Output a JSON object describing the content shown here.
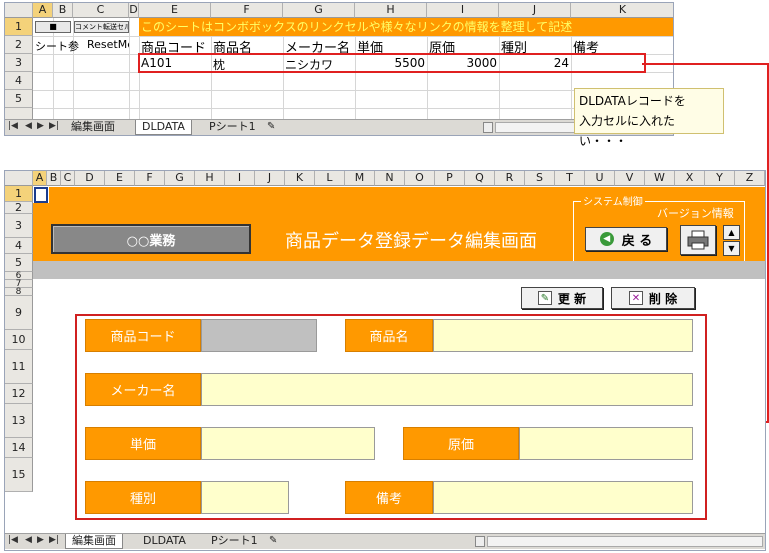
{
  "top_sheet": {
    "columns": [
      "A",
      "B",
      "C",
      "D",
      "E",
      "F",
      "G",
      "H",
      "I",
      "J",
      "K"
    ],
    "rows": [
      "1",
      "2",
      "3",
      "4",
      "5"
    ],
    "row1_banner": "このシートはコンボボックスのリンクセルや様々なリンクの情報を整理して記述",
    "row1_btn_black": "■",
    "row1_btn_comment": "コメント転送セル",
    "row2_b": "シート参",
    "row2_c": "ResetMe",
    "headers": [
      "商品コード",
      "商品名",
      "メーカー名",
      "単価",
      "原価",
      "種別",
      "備考"
    ],
    "record": [
      "A101",
      "枕",
      "ニシカワ",
      "5500",
      "3000",
      "24",
      ""
    ],
    "tabs": [
      "編集画面",
      "DLDATA",
      "Pシート1"
    ]
  },
  "callout": {
    "line1": "DLDATAレコードを",
    "line2": "入力セルに入れたい・・・"
  },
  "bottom_sheet": {
    "columns": [
      "A",
      "B",
      "C",
      "D",
      "E",
      "F",
      "G",
      "H",
      "I",
      "J",
      "K",
      "L",
      "M",
      "N",
      "O",
      "P",
      "Q",
      "R",
      "S",
      "T",
      "U",
      "V",
      "W",
      "X",
      "Y",
      "Z"
    ],
    "rows": [
      "1",
      "2",
      "3",
      "4",
      "5",
      "6",
      "7",
      "8",
      "9",
      "10",
      "11",
      "12",
      "13",
      "14",
      "15"
    ],
    "system_group": "システム制御",
    "version_label": "バージョン情報",
    "business_btn": "○○業務",
    "screen_title": "商品データ登録データ編集画面",
    "back_btn": "戻 る",
    "update_btn": "更 新",
    "delete_btn": "削 除",
    "labels": {
      "code": "商品コード",
      "name": "商品名",
      "maker": "メーカー名",
      "price": "単価",
      "cost": "原価",
      "kind": "種別",
      "note": "備考"
    },
    "tabs": [
      "編集画面",
      "DLDATA",
      "Pシート1"
    ]
  },
  "colors": {
    "accent_orange": "#ff9900",
    "field_yellow": "#ffffcc",
    "connector_red": "#e02020"
  }
}
